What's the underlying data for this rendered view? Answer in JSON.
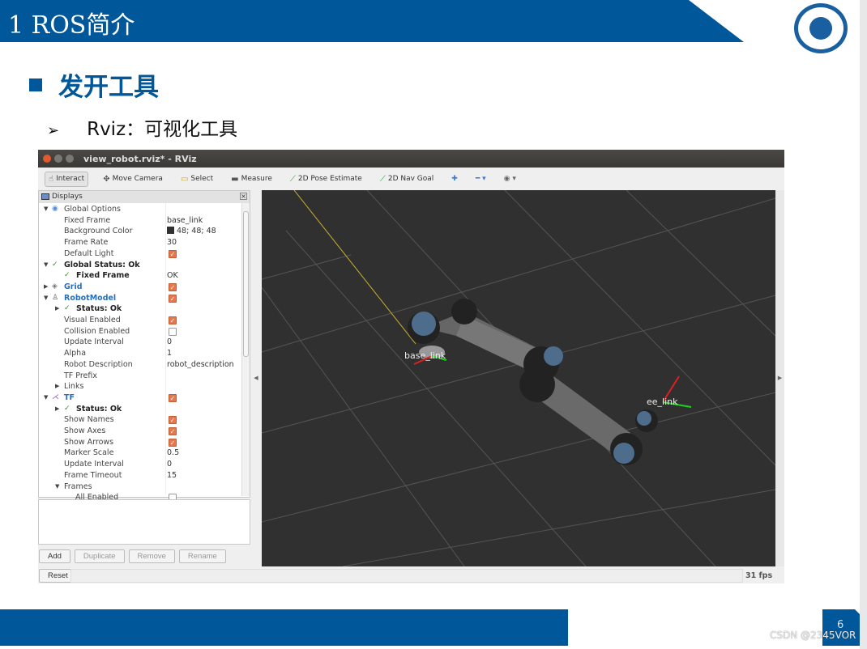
{
  "slide": {
    "title": "1 ROS简介",
    "heading": "发开工具",
    "bullet_marker": "➢",
    "bullet": "Rviz：可视化工具",
    "page_number": "6",
    "watermark": "CSDN @2345VOR"
  },
  "window": {
    "title": "view_robot.rviz* - RViz"
  },
  "toolbar": [
    {
      "label": "Interact",
      "icon": "hand-icon",
      "active": true
    },
    {
      "label": "Move Camera",
      "icon": "move-camera-icon"
    },
    {
      "label": "Select",
      "icon": "select-icon"
    },
    {
      "label": "Measure",
      "icon": "measure-icon"
    },
    {
      "label": "2D Pose Estimate",
      "icon": "pose-arrow-icon"
    },
    {
      "label": "2D Nav Goal",
      "icon": "nav-arrow-icon"
    }
  ],
  "displays": {
    "title": "Displays",
    "rows": [
      {
        "label": "Global Options",
        "level": 0,
        "expander": "open",
        "icon": "globe"
      },
      {
        "label": "Fixed Frame",
        "level": 1,
        "value": "base_link"
      },
      {
        "label": "Background Color",
        "level": 1,
        "value": "48; 48; 48",
        "swatch": "#303030"
      },
      {
        "label": "Frame Rate",
        "level": 1,
        "value": "30"
      },
      {
        "label": "Default Light",
        "level": 1,
        "checked": true
      },
      {
        "label": "Global Status: Ok",
        "level": 0,
        "expander": "open",
        "icon": "check",
        "style": "bold"
      },
      {
        "label": "Fixed Frame",
        "level": 1,
        "icon": "check",
        "style": "bold",
        "value": "OK"
      },
      {
        "label": "Grid",
        "level": 0,
        "expander": "closed",
        "icon": "grid",
        "style": "blue",
        "checked": true
      },
      {
        "label": "RobotModel",
        "level": 0,
        "expander": "open",
        "icon": "robot",
        "style": "blue",
        "checked": true
      },
      {
        "label": "Status: Ok",
        "level": 1,
        "expander": "closed",
        "icon": "check",
        "style": "bold"
      },
      {
        "label": "Visual Enabled",
        "level": 1,
        "checked": true
      },
      {
        "label": "Collision Enabled",
        "level": 1,
        "checked": false
      },
      {
        "label": "Update Interval",
        "level": 1,
        "value": "0"
      },
      {
        "label": "Alpha",
        "level": 1,
        "value": "1"
      },
      {
        "label": "Robot Description",
        "level": 1,
        "value": "robot_description"
      },
      {
        "label": "TF Prefix",
        "level": 1
      },
      {
        "label": "Links",
        "level": 1,
        "expander": "closed"
      },
      {
        "label": "TF",
        "level": 0,
        "expander": "open",
        "icon": "tf",
        "style": "blue",
        "checked": true
      },
      {
        "label": "Status: Ok",
        "level": 1,
        "expander": "closed",
        "icon": "check",
        "style": "bold"
      },
      {
        "label": "Show Names",
        "level": 1,
        "checked": true
      },
      {
        "label": "Show Axes",
        "level": 1,
        "checked": true
      },
      {
        "label": "Show Arrows",
        "level": 1,
        "checked": true
      },
      {
        "label": "Marker Scale",
        "level": 1,
        "value": "0.5"
      },
      {
        "label": "Update Interval",
        "level": 1,
        "value": "0"
      },
      {
        "label": "Frame Timeout",
        "level": 1,
        "value": "15"
      },
      {
        "label": "Frames",
        "level": 1,
        "expander": "open"
      },
      {
        "label": "All Enabled",
        "level": 2,
        "checked": false
      }
    ]
  },
  "buttons": {
    "add": "Add",
    "duplicate": "Duplicate",
    "remove": "Remove",
    "rename": "Rename",
    "reset": "Reset"
  },
  "status": {
    "fps": "31 fps"
  },
  "viewport": {
    "background": "#303030",
    "labels": {
      "base": "base_link",
      "ee": "ee_link"
    }
  }
}
